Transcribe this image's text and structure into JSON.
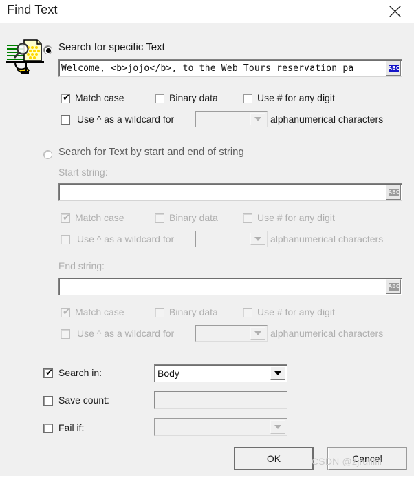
{
  "window": {
    "title": "Find Text",
    "close_icon": "close-icon"
  },
  "icons": {
    "find_text_icon": "find-text-icon",
    "abc_icon": "abc-icon",
    "dropdown_icon": "chevron-down-icon"
  },
  "section_specific": {
    "radio_label": "Search for specific Text",
    "radio_selected": true,
    "search_value": "Welcome, <b>jojo</b>, to the Web Tours reservation pa",
    "options": [
      {
        "label": "Match case",
        "checked": true
      },
      {
        "label": "Binary data",
        "checked": false
      },
      {
        "label": "Use # for any digit",
        "checked": false
      }
    ],
    "wildcard": {
      "label_before": "Use ^ as a wildcard for",
      "label_after": "alphanumerical characters",
      "checked": false,
      "value": ""
    }
  },
  "section_startend": {
    "radio_label": "Search for Text by start and end of string",
    "radio_selected": false,
    "start_label": "Start string:",
    "start_value": "",
    "end_label": "End string:",
    "end_value": "",
    "start_options": [
      {
        "label": "Match case",
        "checked": true
      },
      {
        "label": "Binary data",
        "checked": false
      },
      {
        "label": "Use # for any digit",
        "checked": false
      }
    ],
    "start_wildcard": {
      "label_before": "Use ^ as a wildcard for",
      "label_after": "alphanumerical characters",
      "checked": false,
      "value": ""
    },
    "end_options": [
      {
        "label": "Match case",
        "checked": true
      },
      {
        "label": "Binary data",
        "checked": false
      },
      {
        "label": "Use # for any digit",
        "checked": false
      }
    ],
    "end_wildcard": {
      "label_before": "Use ^ as a wildcard for",
      "label_after": "alphanumerical characters",
      "checked": false,
      "value": ""
    }
  },
  "section_bottom": {
    "search_in": {
      "label": "Search in:",
      "checked": true,
      "value": "Body"
    },
    "save_count": {
      "label": "Save count:",
      "checked": false,
      "value": ""
    },
    "fail_if": {
      "label": "Fail if:",
      "checked": false,
      "value": ""
    }
  },
  "buttons": {
    "ok": "OK",
    "cancel": "Cancel"
  },
  "watermark": "CSDN @zjruiiiiii",
  "colors": {
    "dialog_bg": "#f0f0f0",
    "titlebar_bg": "#ffffff",
    "text": "#1a1a1a",
    "disabled_text": "#aeaeae",
    "abc_blue": "#1414c8",
    "watermark": "#c9c9c9"
  }
}
